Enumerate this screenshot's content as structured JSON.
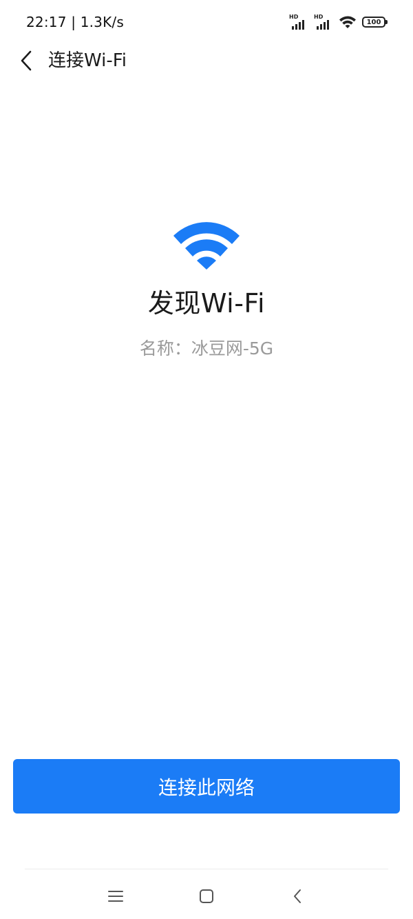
{
  "status_bar": {
    "time_speed": "22:17 | 1.3K/s",
    "hd_label_1": "HD",
    "hd_label_2": "HD",
    "battery": "100"
  },
  "header": {
    "title": "连接Wi-Fi",
    "back_icon": "chevron-left-icon"
  },
  "hero": {
    "icon": "wifi-icon",
    "title": "发现Wi-Fi",
    "subtitle": "名称：冰豆网-5G"
  },
  "actions": {
    "connect_label": "连接此网络"
  },
  "nav_bar": {
    "menu_icon": "menu-icon",
    "home_icon": "home-icon",
    "back_icon": "back-icon"
  },
  "colors": {
    "accent": "#1b7cf6",
    "title_text": "#1a1a1a",
    "subtitle_text": "#9a9a9a",
    "background": "#ffffff"
  }
}
